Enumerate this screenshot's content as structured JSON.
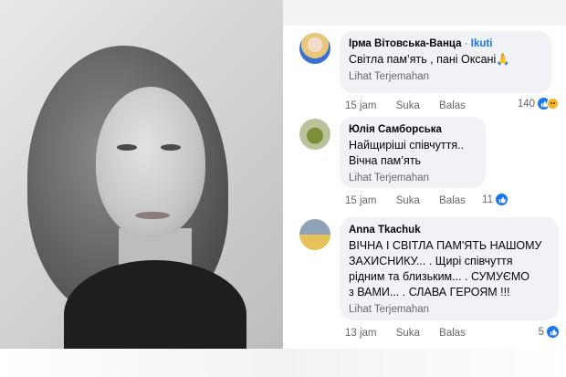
{
  "comments": [
    {
      "author": "Ірма Вітовська-Ванца",
      "follow": "Ikuti",
      "text": [
        "Світла пам’ять , пані Оксані🙏"
      ],
      "translate": "Lihat Terjemahan",
      "time": "15 jam",
      "like": "Suka",
      "reply": "Balas",
      "reactions_count": "140"
    },
    {
      "author": "Юлія Самборська",
      "text": [
        "Найщиріші співчуття..",
        "Вічна пам’ять"
      ],
      "translate": "Lihat Terjemahan",
      "time": "15 jam",
      "like": "Suka",
      "reply": "Balas",
      "reactions_count": "11"
    },
    {
      "author": "Anna Tkachuk",
      "text": [
        "ВІЧНА І СВІТЛА ПАМ'ЯТЬ НАШОМУ",
        "ЗАХИСНИКУ... . Щирі співчуття",
        "рідним та близьким... . СУМУЄМО",
        "з ВАМИ... . СЛАВА ГЕРОЯМ !!!"
      ],
      "translate": "Lihat Terjemahan",
      "time": "13 jam",
      "like": "Suka",
      "reply": "Balas",
      "reactions_count": "5"
    }
  ],
  "icons": {
    "like": "like-thumb-icon",
    "sad": "sad-face-icon"
  },
  "colors": {
    "accent": "#1877f2",
    "bubble": "#f0f2f5",
    "muted": "#65676b"
  }
}
